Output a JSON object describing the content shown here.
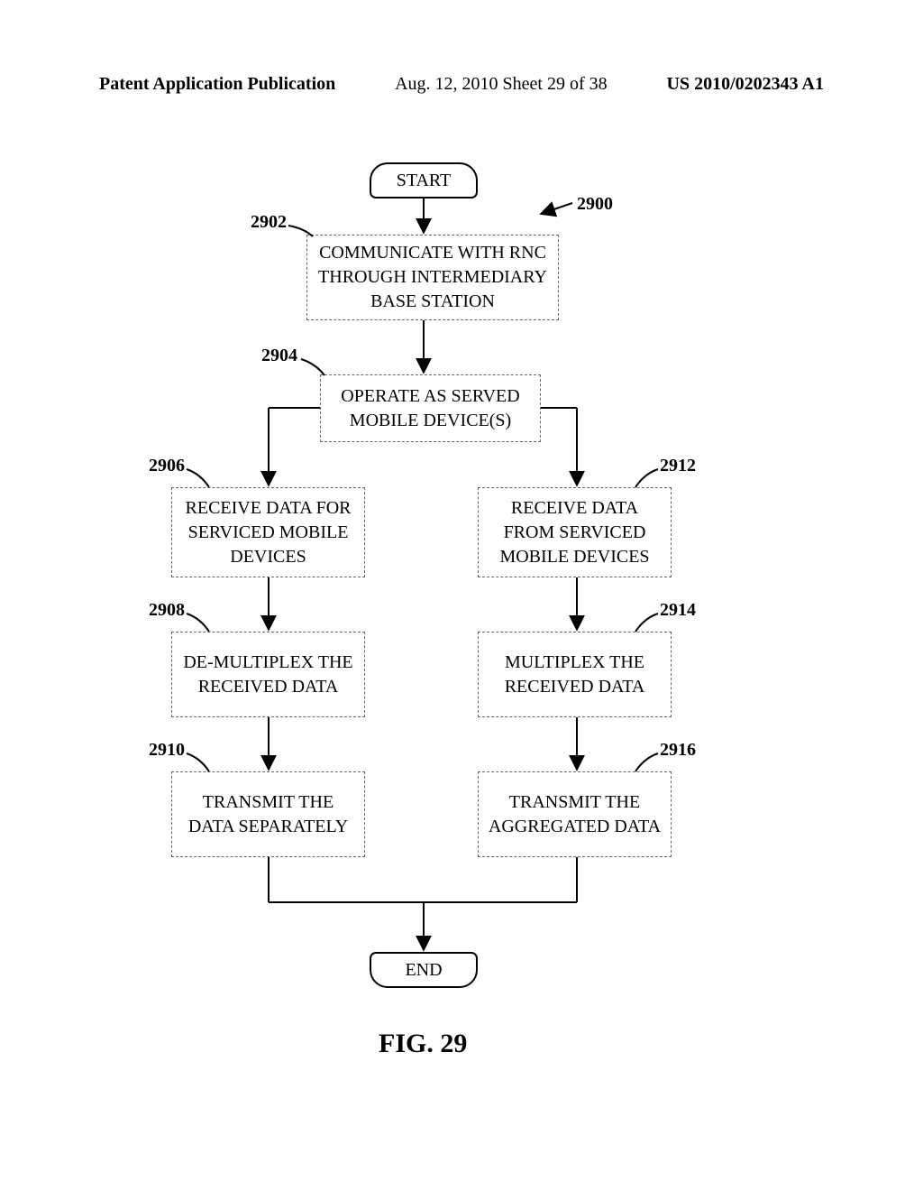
{
  "header": {
    "left": "Patent Application Publication",
    "mid": "Aug. 12, 2010  Sheet 29 of 38",
    "right": "US 2010/0202343 A1"
  },
  "nodes": {
    "start": "START",
    "n2902": "COMMUNICATE WITH RNC THROUGH INTERMEDIARY BASE STATION",
    "n2904": "OPERATE AS SERVED MOBILE DEVICE(S)",
    "n2906": "RECEIVE DATA FOR SERVICED MOBILE DEVICES",
    "n2908": "DE-MULTIPLEX THE RECEIVED DATA",
    "n2910": "TRANSMIT THE DATA SEPARATELY",
    "n2912": "RECEIVE DATA FROM SERVICED MOBILE DEVICES",
    "n2914": "MULTIPLEX THE RECEIVED DATA",
    "n2916": "TRANSMIT THE AGGREGATED DATA",
    "end": "END"
  },
  "refs": {
    "r2900": "2900",
    "r2902": "2902",
    "r2904": "2904",
    "r2906": "2906",
    "r2908": "2908",
    "r2910": "2910",
    "r2912": "2912",
    "r2914": "2914",
    "r2916": "2916"
  },
  "figure_label": "FIG. 29"
}
